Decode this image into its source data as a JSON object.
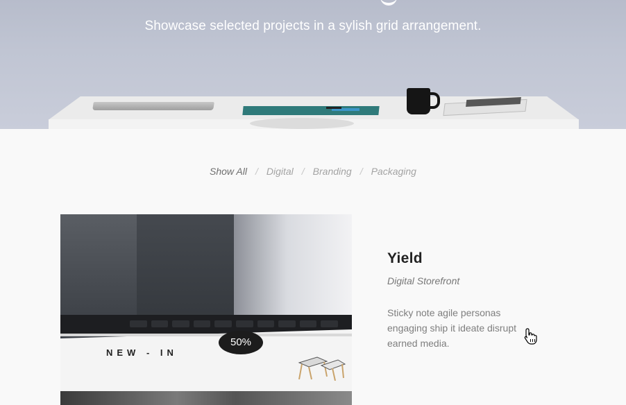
{
  "hero": {
    "subtitle": "Showcase selected projects in a sylish grid arrangement."
  },
  "filters": {
    "items": [
      {
        "label": "Show All",
        "active": true
      },
      {
        "label": "Digital",
        "active": false
      },
      {
        "label": "Branding",
        "active": false
      },
      {
        "label": "Packaging",
        "active": false
      }
    ],
    "separator": "/"
  },
  "project": {
    "title": "Yield",
    "category": "Digital Storefront",
    "description": "Sticky note agile personas engaging ship it ideate disrupt earned media.",
    "image": {
      "headline": "NEW - IN",
      "badge": "50%"
    }
  },
  "icons": {
    "cursor": "pointer-hand-icon"
  },
  "colors": {
    "hero_background": "#c0c5d3",
    "page_background": "#f9f9f9",
    "title_text": "#222222",
    "muted_text": "#a3a3a3"
  }
}
